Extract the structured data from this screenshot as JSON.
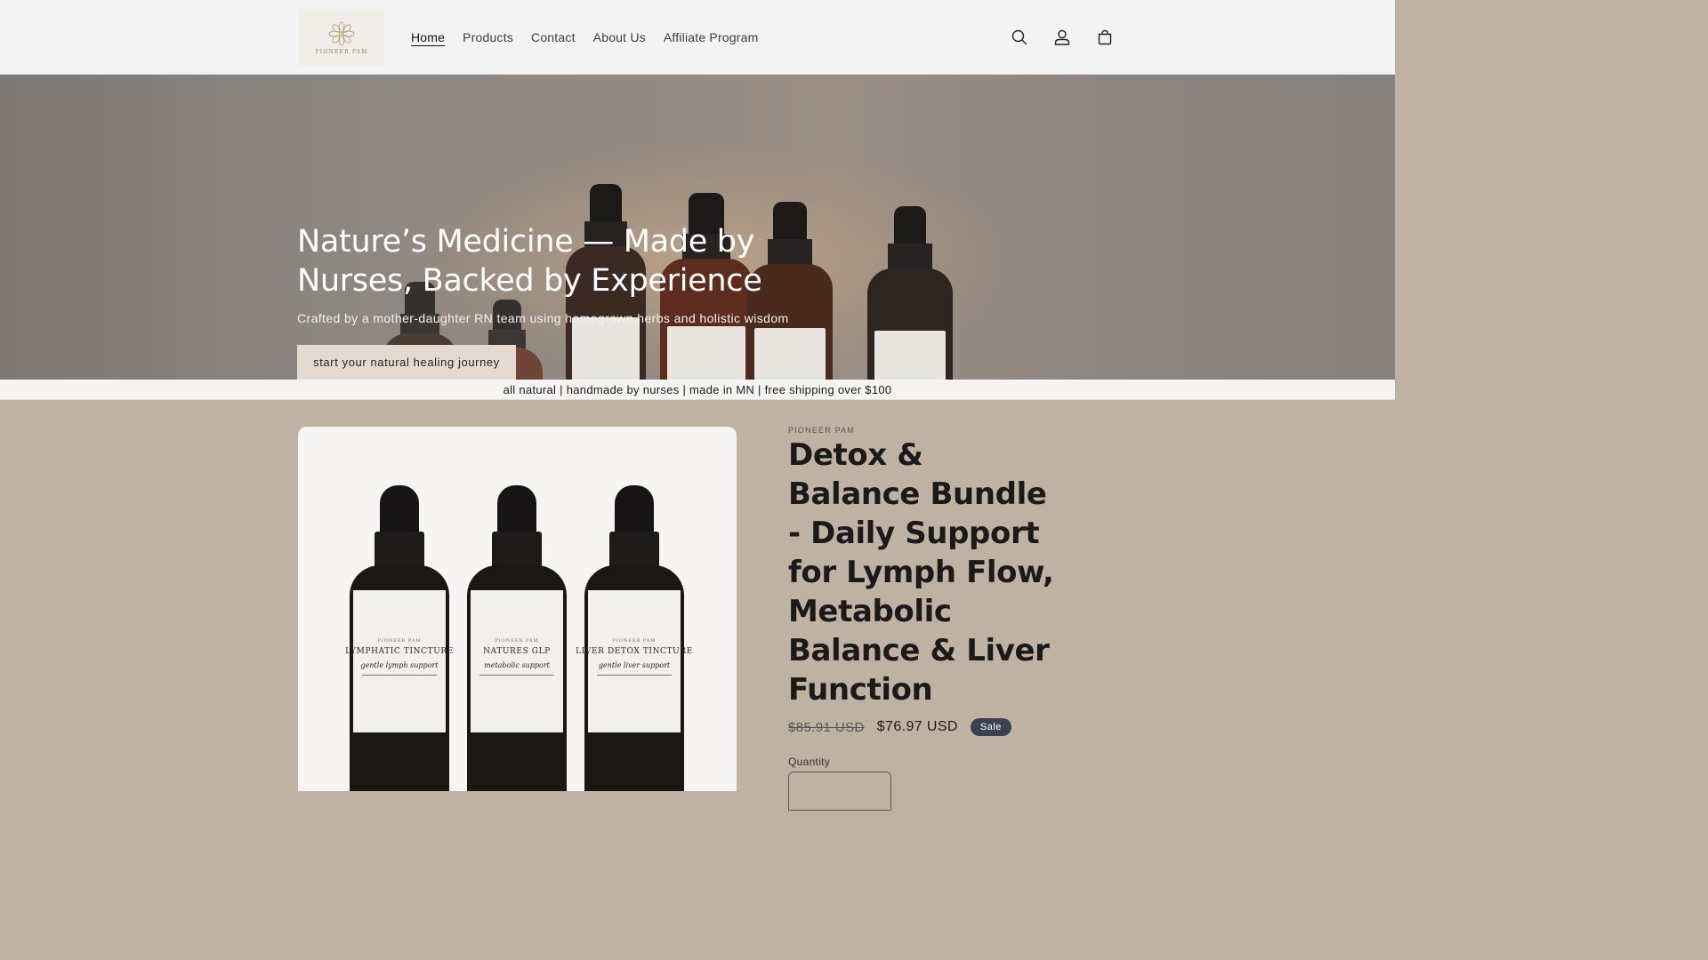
{
  "header": {
    "logo_text": "PIONEER PAM",
    "nav": [
      {
        "label": "Home",
        "active": true
      },
      {
        "label": "Products",
        "active": false
      },
      {
        "label": "Contact",
        "active": false
      },
      {
        "label": "About Us",
        "active": false
      },
      {
        "label": "Affiliate Program",
        "active": false
      }
    ],
    "icons": [
      "search-icon",
      "account-icon",
      "cart-icon"
    ]
  },
  "hero": {
    "title": "Nature’s Medicine — Made by Nurses, Backed by Experience",
    "subtitle": "Crafted by a mother-daughter RN team using homegrown herbs and holistic wisdom",
    "button_label": "start your natural healing journey"
  },
  "announcement": "all natural | handmade by nurses | made in MN | free shipping over $100",
  "product": {
    "vendor": "PIONEER PAM",
    "title": "Detox & Balance Bundle - Daily Support for Lymph Flow, Metabolic Balance & Liver Function",
    "price_regular": "$85.91 USD",
    "price_sale": "$76.97 USD",
    "sale_badge": "Sale",
    "quantity_label": "Quantity",
    "image_bottles": [
      {
        "brand": "PIONEER PAM",
        "name": "LYMPHATIC TINCTURE",
        "tagline": "gentle lymph support"
      },
      {
        "brand": "PIONEER PAM",
        "name": "NATURES GLP",
        "tagline": "metabolic support"
      },
      {
        "brand": "PIONEER PAM",
        "name": "LIVER DETOX TINCTURE",
        "tagline": "gentle liver support"
      }
    ]
  },
  "colors": {
    "page_background": "#c0b2a3",
    "header_background": "#f3f3f3",
    "hero_button": "#e4dbd0",
    "sale_badge": "#3a4150"
  }
}
